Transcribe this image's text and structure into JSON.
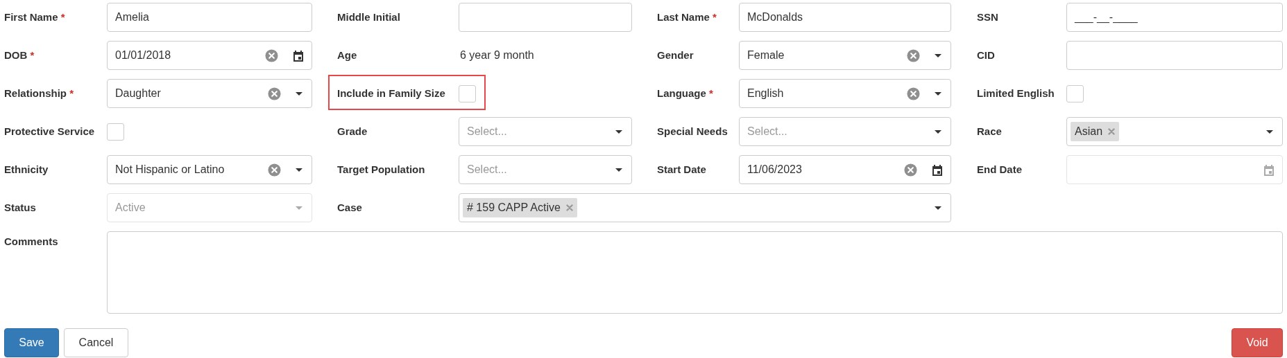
{
  "rows": [
    [
      {
        "label": "First Name",
        "required_mark": "*",
        "field": {
          "kind": "text",
          "value": "Amelia"
        }
      },
      {
        "label": "Middle Initial",
        "field": {
          "kind": "text"
        }
      },
      {
        "label": "Last Name",
        "required_mark": "*",
        "field": {
          "kind": "text",
          "value": "McDonalds"
        }
      },
      {
        "label": "SSN",
        "field": {
          "kind": "text",
          "value": "___-__-____"
        }
      }
    ],
    [
      {
        "label": "DOB",
        "required_mark": "*",
        "field": {
          "kind": "date",
          "value": "01/01/2018",
          "disabled": false
        }
      },
      {
        "label": "Age",
        "field": {
          "kind": "static",
          "value": "6 year 9 month"
        }
      },
      {
        "label": "Gender",
        "field": {
          "kind": "select",
          "value": "Female",
          "disabled": false
        }
      },
      {
        "label": "CID",
        "field": {
          "kind": "text"
        }
      }
    ],
    [
      {
        "label": "Relationship",
        "required_mark": "*",
        "field": {
          "kind": "select",
          "value": "Daughter",
          "disabled": false
        }
      },
      {
        "label": "Include in Family Size",
        "highlighted": true,
        "field": {
          "kind": "checkbox",
          "checked": false
        }
      },
      {
        "label": "Language",
        "required_mark": "*",
        "field": {
          "kind": "select",
          "value": "English",
          "disabled": false
        }
      },
      {
        "label": "Limited English",
        "highlighted": false,
        "field": {
          "kind": "checkbox",
          "checked": false
        }
      }
    ],
    [
      {
        "label": "Protective Service",
        "highlighted": false,
        "field": {
          "kind": "checkbox",
          "checked": false
        }
      },
      {
        "label": "Grade",
        "field": {
          "kind": "select",
          "placeholder": "Select...",
          "disabled": false
        }
      },
      {
        "label": "Special Needs",
        "field": {
          "kind": "select",
          "placeholder": "Select...",
          "disabled": false
        }
      },
      {
        "label": "Race",
        "field": {
          "kind": "multiselect",
          "tags": [
            "Asian"
          ],
          "wide": false
        }
      }
    ],
    [
      {
        "label": "Ethnicity",
        "field": {
          "kind": "select",
          "value": "Not Hispanic or Latino",
          "disabled": false
        }
      },
      {
        "label": "Target Population",
        "field": {
          "kind": "select",
          "placeholder": "Select...",
          "disabled": false
        }
      },
      {
        "label": "Start Date",
        "field": {
          "kind": "date",
          "value": "11/06/2023",
          "disabled": false
        }
      },
      {
        "label": "End Date",
        "field": {
          "kind": "date",
          "disabled": true
        }
      }
    ],
    [
      {
        "label": "Status",
        "field": {
          "kind": "select",
          "value": "Active",
          "disabled": true
        }
      },
      {
        "label": "Case",
        "field": {
          "kind": "multiselect",
          "tags": [
            "# 159 CAPP Active"
          ],
          "wide": true
        }
      }
    ]
  ],
  "comments": {
    "label": "Comments"
  },
  "buttons": [
    {
      "label": "Save",
      "kind": "primary"
    },
    {
      "label": "Cancel",
      "kind": "default"
    },
    {
      "label": "Void",
      "kind": "danger"
    }
  ]
}
